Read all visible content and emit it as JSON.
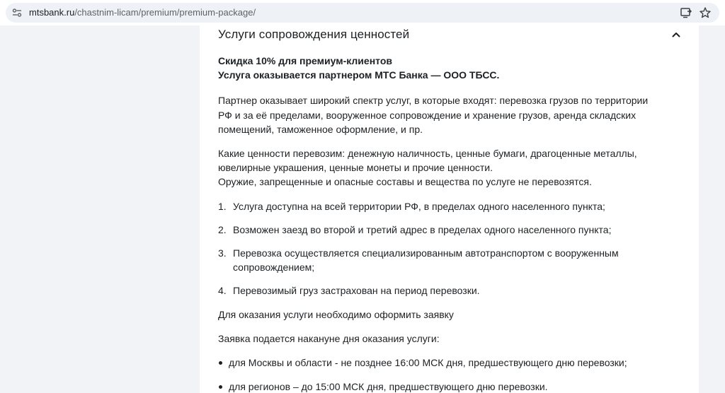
{
  "browser": {
    "url_host": "mtsbank.ru",
    "url_path": "/chastnim-licam/premium/premium-package/"
  },
  "section": {
    "title": "Услуги сопровождения ценностей",
    "bold_lines": [
      "Скидка 10% для премиум-клиентов",
      "Услуга оказывается партнером МТС Банка — ООО ТБСС."
    ],
    "paragraph_services": "Партнер оказывает широкий спектр услуг, в которые входят: перевозка грузов по территории РФ и за её пределами, вооруженное сопровождение и хранение грузов, аренда складских помещений, таможенное оформление, и пр.",
    "paragraph_values_1": "Какие ценности перевозим: денежную наличность, ценные бумаги, драгоценные металлы, ювелирные украшения, ценные монеты и прочие ценности.",
    "paragraph_values_2": "Оружие, запрещенные и опасные составы и вещества по услуге не перевозятся.",
    "numbered_items": [
      {
        "num": "1.",
        "text": "Услуга доступна на всей территории РФ, в пределах одного населенного пункта;"
      },
      {
        "num": "2.",
        "text": "Возможен заезд во второй и третий адрес в пределах одного населенного пункта;"
      },
      {
        "num": "3.",
        "text": "Перевозка осуществляется специализированным автотранспортом с вооруженным сопровождением;"
      },
      {
        "num": "4.",
        "text": "Перевозимый груз застрахован на период перевозки."
      }
    ],
    "application_note": "Для оказания услуги необходимо оформить заявку",
    "application_timing": "Заявка подается накануне дня оказания услуги:",
    "bullet_items": [
      "для Москвы и области - не позднее 16:00 МСК дня, предшествующего дню перевозки;",
      "для регионов – до 15:00 МСК дня, предшествующего дню перевозки."
    ]
  }
}
